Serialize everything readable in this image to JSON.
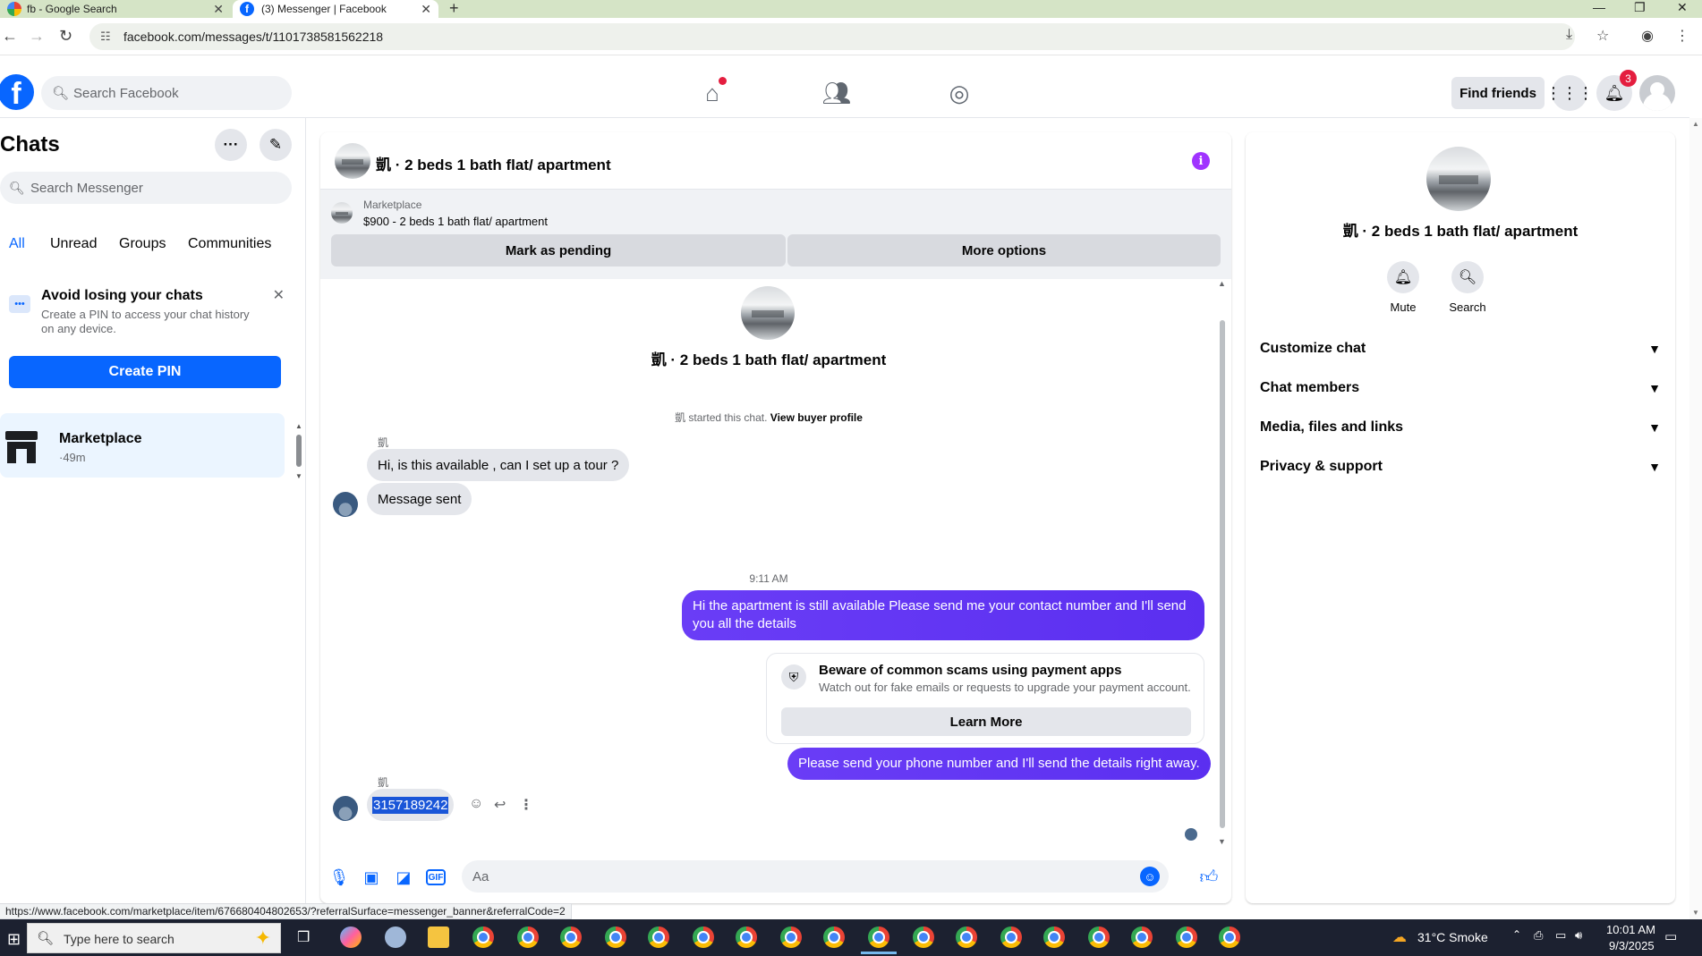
{
  "browser": {
    "tabs": [
      {
        "title": "fb - Google Search"
      },
      {
        "title": "(3) Messenger | Facebook"
      }
    ],
    "url": "facebook.com/messages/t/1101738581562218",
    "status_url": "https://www.facebook.com/marketplace/item/676680404802653/?referralSurface=messenger_banner&referralCode=2"
  },
  "topnav": {
    "logo": "f",
    "search_placeholder": "Search Facebook",
    "find_friends": "Find friends",
    "notification_count": "3"
  },
  "left": {
    "title": "Chats",
    "search_placeholder": "Search Messenger",
    "filters": [
      "All",
      "Unread",
      "Groups",
      "Communities"
    ],
    "pin_card": {
      "title": "Avoid losing your chats",
      "desc": "Create a PIN to access your chat history on any device.",
      "button": "Create PIN"
    },
    "chats": [
      {
        "name": "Marketplace",
        "time": "·49m"
      }
    ]
  },
  "conversation": {
    "title": "凱 · 2 beds 1 bath flat/ apartment",
    "banner": {
      "label": "Marketplace",
      "listing": "$900 - 2 beds 1 bath flat/ apartment",
      "pending_btn": "Mark as pending",
      "more_btn": "More options"
    },
    "intro_name": "凱 · 2 beds 1 bath flat/ apartment",
    "started_prefix": "凱 started this chat. ",
    "started_link": "View buyer profile",
    "sender_name": "凱",
    "msg_in_1": "Hi, is this available , can I set up a  tour ?",
    "msg_in_2": "Message sent",
    "timestamp": "9:11 AM",
    "msg_out_1": "Hi the apartment is still available Please send me your contact number and I'll send you all the details",
    "scam_title": "Beware of common scams using payment apps",
    "scam_desc": "Watch out for fake emails or requests to upgrade your payment account.",
    "scam_btn": "Learn More",
    "msg_out_2": "Please send your phone number and I'll send the details right away.",
    "msg_in_3": "3157189242",
    "composer_placeholder": "Aa"
  },
  "right": {
    "name": "凱 · 2 beds 1 bath flat/ apartment",
    "mute": "Mute",
    "search": "Search",
    "sections": [
      "Customize chat",
      "Chat members",
      "Media, files and links",
      "Privacy & support"
    ]
  },
  "taskbar": {
    "search_placeholder": "Type here to search",
    "weather": "31°C  Smoke",
    "time": "10:01 AM",
    "date": "9/3/2025"
  }
}
